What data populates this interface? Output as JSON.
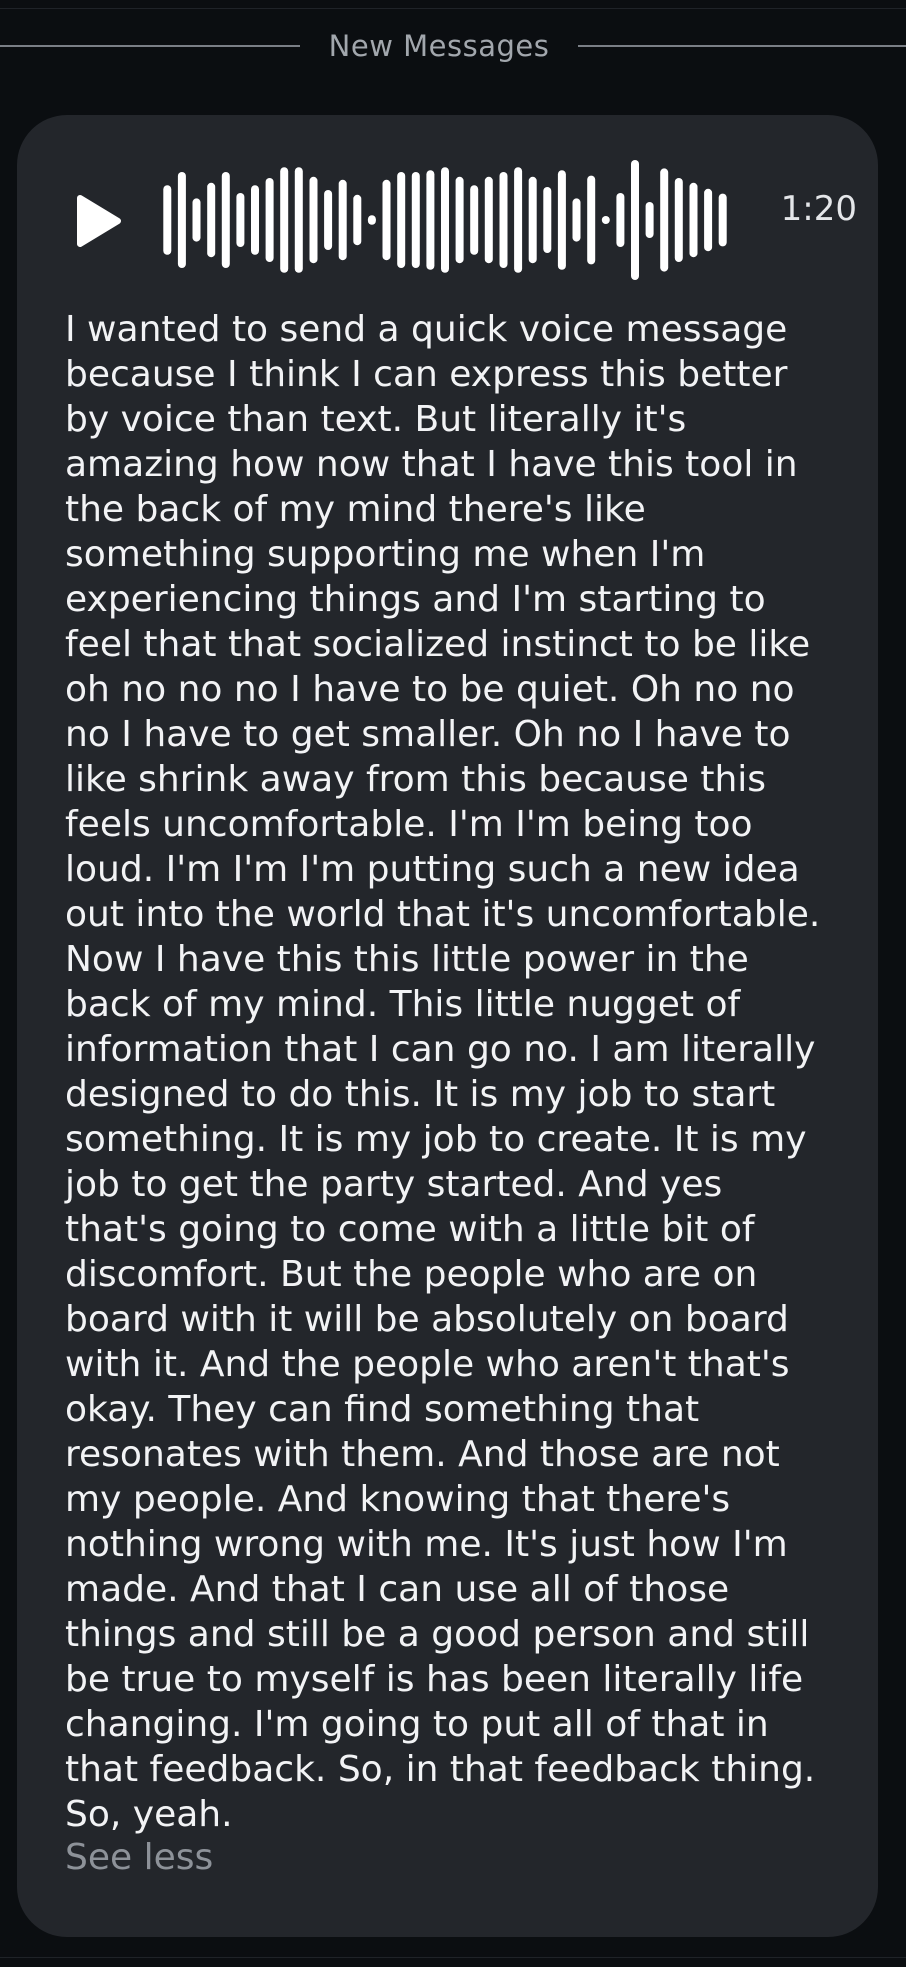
{
  "divider": {
    "label": "New Messages"
  },
  "voice_message": {
    "duration": "1:20",
    "play_icon": "play-icon",
    "waveform_levels": [
      0.58,
      0.8,
      0.36,
      0.62,
      0.8,
      0.45,
      0.58,
      0.7,
      0.88,
      0.88,
      0.72,
      0.5,
      0.67,
      0.42,
      0.08,
      0.67,
      0.8,
      0.8,
      0.83,
      0.88,
      0.72,
      0.58,
      0.72,
      0.8,
      0.88,
      0.72,
      0.55,
      0.83,
      0.36,
      0.74,
      0.06,
      0.45,
      1.0,
      0.3,
      0.86,
      0.7,
      0.62,
      0.52,
      0.44
    ],
    "transcript": "I wanted to send a quick voice message\nbecause I think I can express this better\nby voice than text. But literally it's\namazing how now that I have this tool in\nthe back of my mind there's like\nsomething supporting me when I'm\nexperiencing things and I'm starting to\nfeel that that socialized instinct to be like\noh no no no I have to be quiet. Oh no no\nno I have to get smaller. Oh no I have to\nlike shrink away from this because this\nfeels uncomfortable. I'm I'm being too\nloud. I'm I'm I'm putting such a new idea\nout into the world that it's uncomfortable.\nNow I have this this little power in the\nback of my mind. This little nugget of\ninformation that I can go no. I am literally\ndesigned to do this. It is my job to start\nsomething. It is my job to create. It is my\njob to get the party started. And yes\nthat's going to come with a little bit of\ndiscomfort. But the people who are on\nboard with it will be absolutely on board\nwith it. And the people who aren't that's\nokay. They can find something that\nresonates with them. And those are not\nmy people. And knowing that there's\nnothing wrong with me. It's just how I'm\nmade. And that I can use all of those\nthings and still be a good person and still\nbe true to myself is has been literally life\nchanging. I'm going to put all of that in\nthat feedback. So, in that feedback thing.\nSo, yeah.",
    "see_less_label": "See less"
  },
  "colors": {
    "background": "#0b0e11",
    "card": "#23262b",
    "text": "#f2f3f5",
    "muted": "#8d9299",
    "waveform": "#ffffff"
  }
}
